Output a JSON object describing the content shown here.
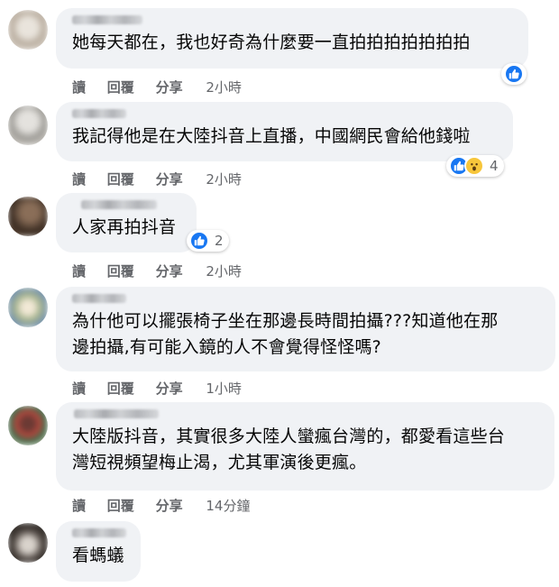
{
  "action_labels": {
    "read": "讀",
    "reply": "回覆",
    "share": "分享"
  },
  "colors": {
    "bubble": "#f0f2f5",
    "like_blue": "#1877f2",
    "meta_gray": "#65676b",
    "wow_yellow": "#f7c63b"
  },
  "comments": [
    {
      "text_lines": [
        "她每天都在，我也好奇為什麼要一直拍拍拍拍拍拍拍"
      ],
      "time": "2小時",
      "reactions": [
        "like"
      ],
      "reaction_count": ""
    },
    {
      "text_lines": [
        "我記得他是在大陸抖音上直播，中國網民會給他錢啦"
      ],
      "time": "2小時",
      "reactions": [
        "like",
        "wow"
      ],
      "reaction_count": "4"
    },
    {
      "text_lines": [
        "人家再拍抖音"
      ],
      "time": "2小時",
      "reactions": [
        "like"
      ],
      "reaction_count": "2"
    },
    {
      "text_lines": [
        "為什他可以擺張椅子坐在那邊長時間拍攝???知道他在那",
        "邊拍攝,有可能入鏡的人不會覺得怪怪嗎?"
      ],
      "time": "1小時",
      "reactions": [],
      "reaction_count": ""
    },
    {
      "text_lines": [
        "大陸版抖音，其實很多大陸人蠻瘋台灣的，都愛看這些台",
        "灣短視頻望梅止渴，尤其軍演後更瘋。"
      ],
      "time": "14分鐘",
      "reactions": [],
      "reaction_count": ""
    },
    {
      "text_lines": [
        "看螞蟻"
      ],
      "time": "",
      "reactions": [],
      "reaction_count": ""
    }
  ]
}
